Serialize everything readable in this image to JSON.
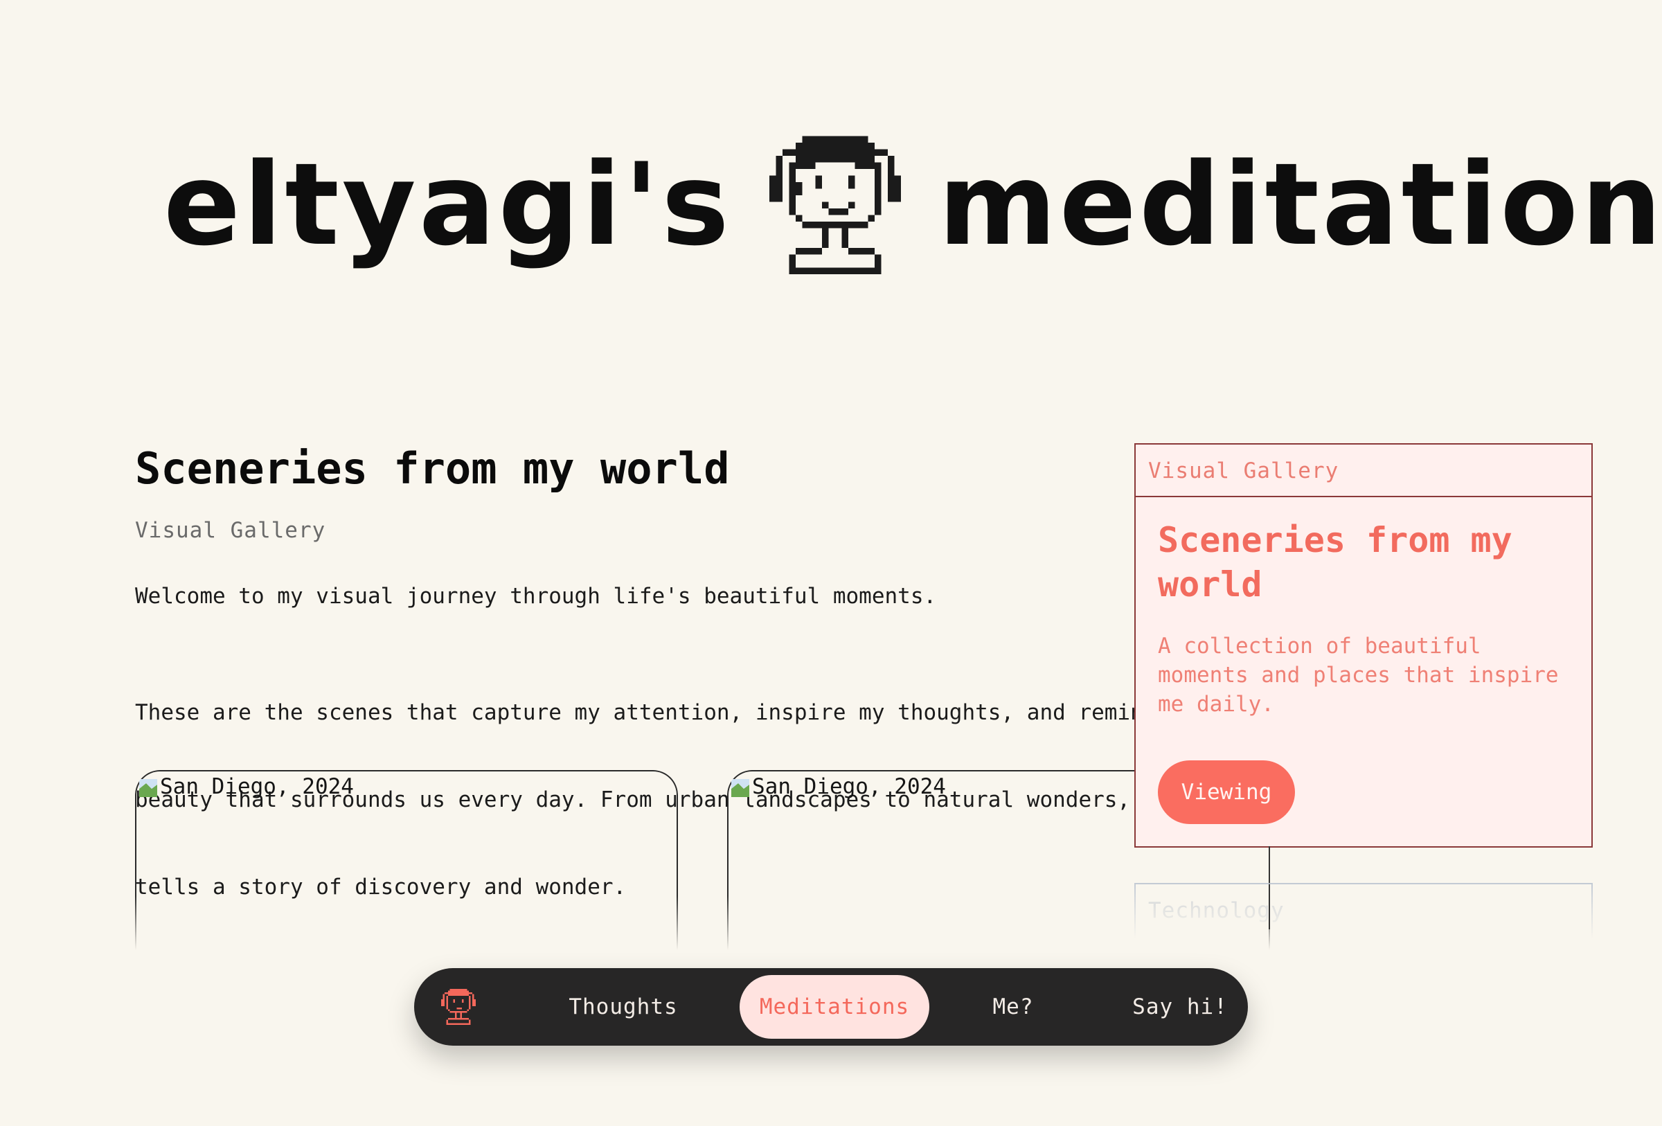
{
  "hero": {
    "name": "eltyagi's",
    "section": "meditations",
    "avatar_icon": "pixel-avatar-icon"
  },
  "main": {
    "title": "Sceneries from my world",
    "subtitle": "Visual Gallery",
    "para1": "Welcome to my visual journey through life's beautiful moments.",
    "para2_lines": [
      "These are the scenes that capture my attention, inspire my thoughts, and remind me of the",
      "beauty that surrounds us every day. From urban landscapes to natural wonders, each image",
      "tells a story of discovery and wonder."
    ]
  },
  "gallery": [
    {
      "alt": "San Diego, 2024"
    },
    {
      "alt": "San Diego, 2024"
    }
  ],
  "panel": {
    "category": "Visual Gallery",
    "title": "Sceneries from my world",
    "description": "A collection of beautiful moments and places that inspire me daily.",
    "button": "Viewing",
    "next_category": "Technology"
  },
  "nav": {
    "logo_icon": "pixel-avatar-icon",
    "items": [
      {
        "label": "Thoughts",
        "active": false
      },
      {
        "label": "Meditations",
        "active": true
      },
      {
        "label": "Me?",
        "active": false
      },
      {
        "label": "Say hi!",
        "active": false
      }
    ]
  },
  "colors": {
    "background": "#f9f6ee",
    "accent": "#fa6d60",
    "panel_bg": "#fff0ee",
    "nav_bg": "#272626",
    "nav_active_bg": "#ffe3e0"
  }
}
